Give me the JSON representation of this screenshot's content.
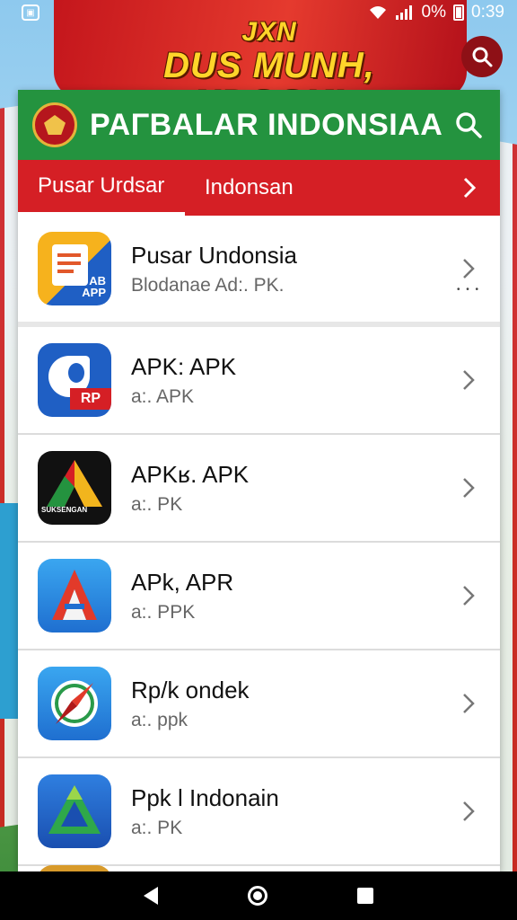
{
  "status_bar": {
    "battery": "0%",
    "time": "0:39"
  },
  "banner": {
    "line1": "JXN",
    "line2": "DUS MUNH, NDOOK!"
  },
  "app": {
    "title": "PAΓBALAR INDONSIAA",
    "tabs": [
      {
        "label": "Pusar Urdsar"
      },
      {
        "label": "Indonsan"
      }
    ]
  },
  "list": [
    {
      "title": "Pusar Undonsia",
      "subtitle": "Blodanae Ad:. PK.",
      "icon": "document-apk-icon",
      "icon_text": "AB\nAPP"
    },
    {
      "title": "APK: APK",
      "subtitle": "a:. APK",
      "icon": "bird-icon",
      "icon_text": "RP"
    },
    {
      "title": "APKʁ. APK",
      "subtitle": "a:. PK",
      "icon": "triangle-logo-icon",
      "icon_text": "SUKSENGAN"
    },
    {
      "title": "APk, APR",
      "subtitle": "a:. PPK",
      "icon": "letter-a-icon",
      "icon_text": ""
    },
    {
      "title": "Rp/k ondek",
      "subtitle": "a:. ppk",
      "icon": "compass-icon",
      "icon_text": ""
    },
    {
      "title": "Ppk l Indonain",
      "subtitle": "a:. PK",
      "icon": "delta-icon",
      "icon_text": ""
    }
  ],
  "colors": {
    "header_green": "#24933f",
    "tab_red": "#d51f25",
    "banner_yellow": "#ffd52a"
  }
}
